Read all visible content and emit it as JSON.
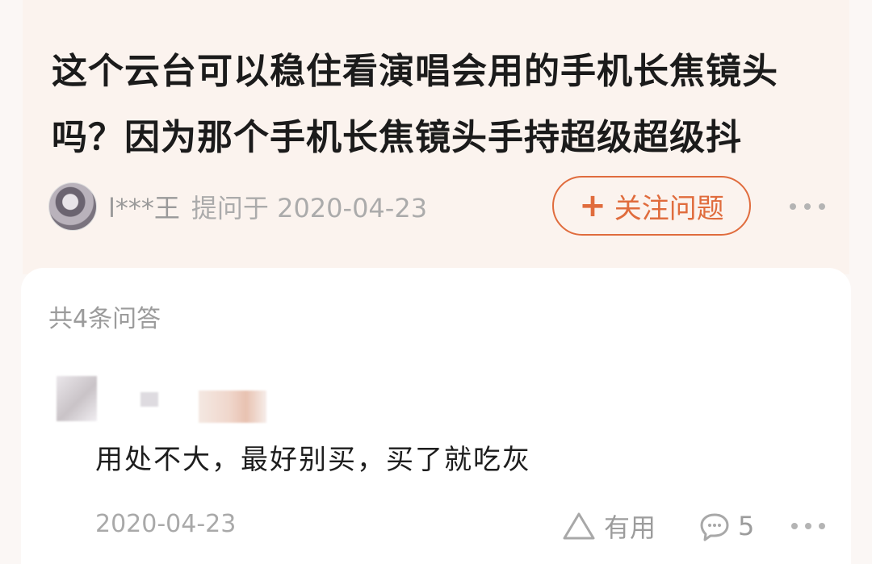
{
  "question": {
    "title": "这个云台可以稳住看演唱会用的手机长焦镜头吗？因为那个手机长焦镜头手持超级超级抖",
    "asker_name": "l***王",
    "asked_meta": "提问于 2020-04-23",
    "follow_label": "关注问题",
    "follow_plus": "+",
    "avatar_icon": "avatar-icon",
    "more_icon": "more-horizontal-icon"
  },
  "answers": {
    "count_label": "共4条问答",
    "items": [
      {
        "text": "用处不大，最好别买，买了就吃灰",
        "date": "2020-04-23",
        "useful_label": "有用",
        "comment_count": "5",
        "useful_icon": "triangle-like-icon",
        "comment_icon": "comment-bubble-icon",
        "more_icon": "more-horizontal-icon"
      }
    ]
  },
  "colors": {
    "accent": "#e06c3d",
    "question_bg": "#fbf3ee",
    "text_dark": "#1b1b1b",
    "text_muted": "#9b9b9b"
  }
}
